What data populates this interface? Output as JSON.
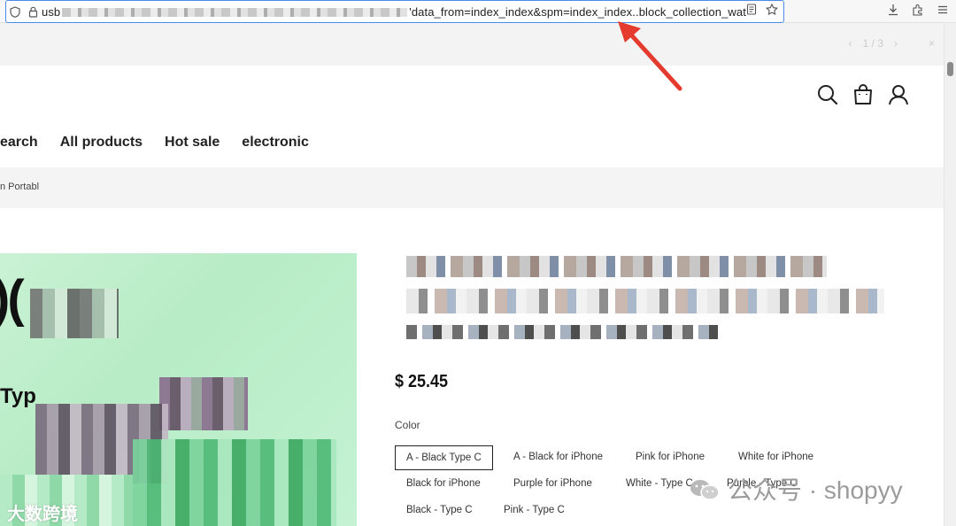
{
  "browser": {
    "url_prefix": "usb",
    "url_suffix": "'data_from=index_index&spm=index_index..block_collection_waterfa",
    "left_icons": [
      "shield-icon",
      "lock-icon"
    ],
    "right_icons": [
      "reader-mode-icon",
      "star-icon"
    ],
    "toolbar_icons": [
      "download-icon",
      "extensions-icon",
      "menu-icon"
    ]
  },
  "pager": {
    "text": "1 / 3"
  },
  "header": {
    "icons": [
      "search-icon",
      "cart-icon",
      "account-icon"
    ]
  },
  "nav": {
    "items": [
      {
        "label": "earch"
      },
      {
        "label": "All products"
      },
      {
        "label": "Hot sale"
      },
      {
        "label": "electronic"
      }
    ]
  },
  "breadcrumb": {
    "text": "n Portabl"
  },
  "product_image": {
    "big_text": ")(",
    "small_text": "Typ",
    "watermark": "大数跨境"
  },
  "product": {
    "price": "$ 25.45",
    "color_label": "Color",
    "options": [
      {
        "label": "A - Black Type C",
        "selected": true
      },
      {
        "label": "A - Black for iPhone",
        "selected": false
      },
      {
        "label": "Pink for iPhone",
        "selected": false
      },
      {
        "label": "White for iPhone",
        "selected": false
      },
      {
        "label": "Black for iPhone",
        "selected": false
      },
      {
        "label": "Purple for iPhone",
        "selected": false
      },
      {
        "label": "White - Type C",
        "selected": false
      },
      {
        "label": "Purple - Type C",
        "selected": false
      },
      {
        "label": "Black - Type C",
        "selected": false
      },
      {
        "label": "Pink - Type C",
        "selected": false
      }
    ]
  },
  "watermark": {
    "text": "公众号 · shopyy"
  },
  "colors": {
    "url_focus": "#4a8be8",
    "arrow": "#e53a2e",
    "image_bg": "#c4f0d1"
  }
}
